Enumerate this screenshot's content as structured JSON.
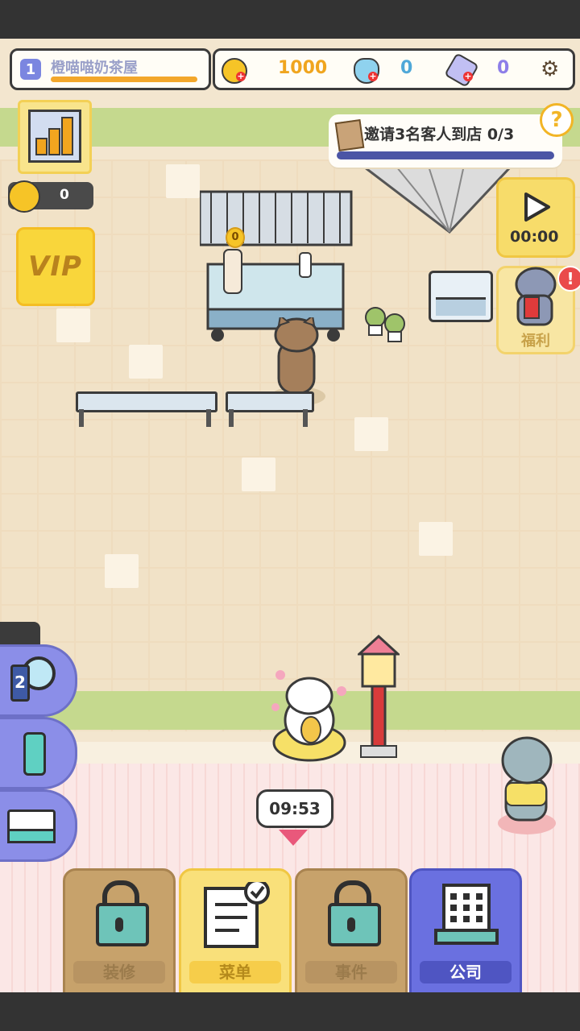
{
  "shop": {
    "level": "1",
    "name": "橙喵喵奶茶屋"
  },
  "currencies": {
    "coins": "1000",
    "potion": "0",
    "gem": "0"
  },
  "boost": {
    "value": "0"
  },
  "vip": {
    "label": "VIP"
  },
  "quest": {
    "text": "邀请3名客人到店 0/3",
    "help": "?"
  },
  "video": {
    "time": "00:00"
  },
  "gift": {
    "label": "福利",
    "alert": "!"
  },
  "counter": {
    "coin_badge": "0"
  },
  "side_panel": {
    "magnifier_badge": "2"
  },
  "timer": {
    "value": "09:53"
  },
  "nav": {
    "items": [
      {
        "label": "装修",
        "locked": true
      },
      {
        "label": "菜单",
        "locked": false
      },
      {
        "label": "事件",
        "locked": true
      },
      {
        "label": "公司",
        "locked": false
      }
    ]
  },
  "colors": {
    "coin": "#f6c427",
    "potion": "#4fa8d8",
    "gem": "#8d7ee8",
    "accent_orange": "#f3a72b",
    "nav_active": "#6a70e0"
  }
}
